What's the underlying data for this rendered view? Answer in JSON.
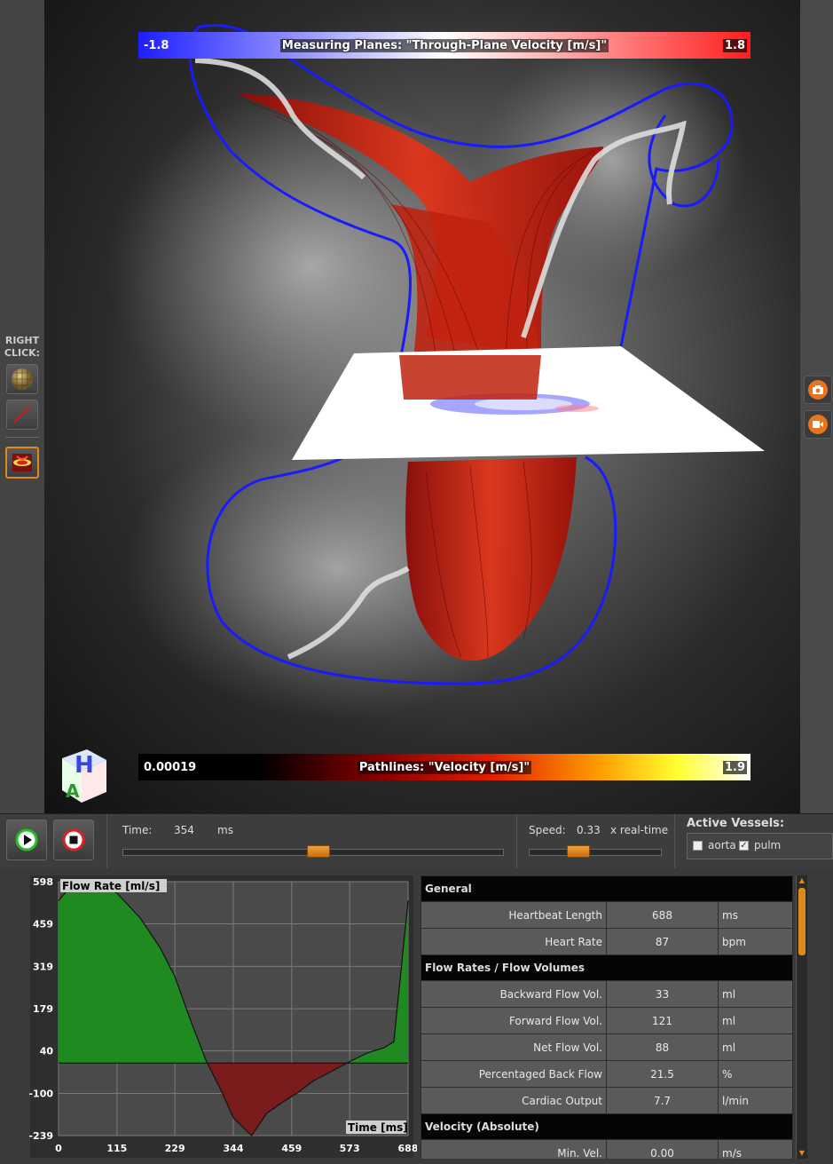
{
  "sidebar": {
    "right_click_label": "RIGHT\nCLICK:",
    "tools": [
      {
        "icon": "sphere-mesh-icon"
      },
      {
        "icon": "line-tool-icon"
      },
      {
        "icon": "plane-flow-icon"
      }
    ]
  },
  "viewport": {
    "plane_legend": {
      "title": "Measuring Planes: \"Through-Plane Velocity [m/s]\"",
      "min": "-1.8",
      "max": "1.8"
    },
    "pathline_legend": {
      "title": "Pathlines: \"Velocity [m/s]\"",
      "min": "0.00019",
      "max": "1.9"
    },
    "orientation_cube": {
      "top": "H",
      "front": "A"
    },
    "colors": {
      "vessel_outline": "#1a1aff",
      "pathlines": "#c81e10",
      "plane": "#ffffff"
    }
  },
  "right_tools": {
    "screenshot_icon": "camera-icon",
    "record_icon": "video-camera-icon"
  },
  "playback": {
    "time_label": "Time:",
    "time_value": "354",
    "time_unit": "ms",
    "time_fraction": 0.515,
    "speed_label": "Speed:",
    "speed_value": "0.33",
    "speed_unit": "x real-time",
    "speed_fraction": 0.37
  },
  "active_vessels": {
    "label": "Active Vessels:",
    "items": [
      {
        "name": "aorta",
        "checked": false
      },
      {
        "name": "pulm",
        "checked": true
      }
    ]
  },
  "chart_data": {
    "type": "area",
    "title": "Flow Rate [ml/s]",
    "xlabel": "Time [ms]",
    "ylabel": "Flow Rate [ml/s]",
    "xlim": [
      0,
      688
    ],
    "ylim": [
      -239,
      598
    ],
    "x_ticks": [
      "0",
      "115",
      "229",
      "344",
      "459",
      "573",
      "688"
    ],
    "y_ticks": [
      "598",
      "459",
      "319",
      "179",
      "40",
      "-100",
      "-239"
    ],
    "grid": true,
    "positive_color": "#1f8a1f",
    "negative_color": "#7a1c1c",
    "series": [
      {
        "x": [
          0,
          20,
          50,
          80,
          115,
          160,
          200,
          229,
          260,
          290,
          320,
          344,
          380,
          410,
          440,
          470,
          500,
          540,
          573,
          610,
          640,
          660,
          688
        ],
        "values": [
          535,
          575,
          598,
          590,
          560,
          480,
          380,
          285,
          140,
          10,
          -90,
          -180,
          -239,
          -165,
          -130,
          -98,
          -60,
          -25,
          5,
          35,
          50,
          70,
          535
        ]
      }
    ]
  },
  "table": {
    "sections": [
      {
        "title": "General",
        "rows": [
          {
            "label": "Heartbeat Length",
            "value": "688",
            "unit": "ms"
          },
          {
            "label": "Heart Rate",
            "value": "87",
            "unit": "bpm"
          }
        ]
      },
      {
        "title": "Flow Rates / Flow Volumes",
        "rows": [
          {
            "label": "Backward Flow Vol.",
            "value": "33",
            "unit": "ml"
          },
          {
            "label": "Forward Flow Vol.",
            "value": "121",
            "unit": "ml"
          },
          {
            "label": "Net Flow Vol.",
            "value": "88",
            "unit": "ml"
          },
          {
            "label": "Percentaged Back Flow",
            "value": "21.5",
            "unit": "%"
          },
          {
            "label": "Cardiac Output",
            "value": "7.7",
            "unit": "l/min"
          }
        ]
      },
      {
        "title": "Velocity (Absolute)",
        "rows": [
          {
            "label": "Min. Vel.",
            "value": "0.00",
            "unit": "m/s"
          }
        ]
      }
    ]
  }
}
